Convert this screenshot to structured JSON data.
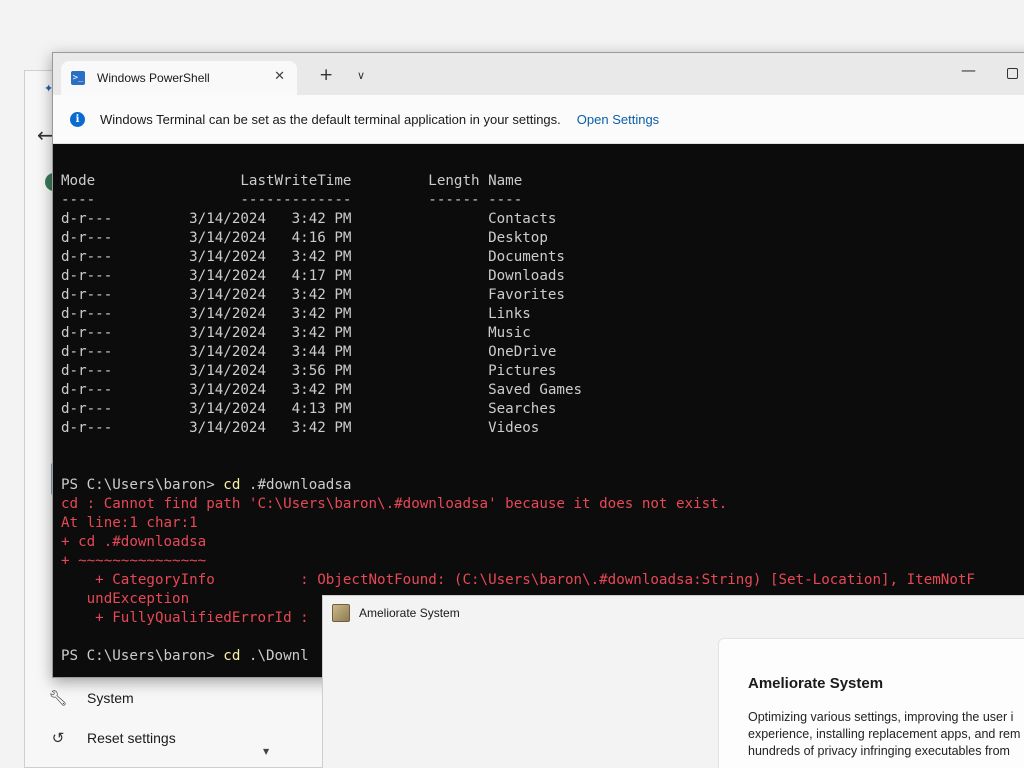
{
  "background_window": {
    "sidebar": [
      {
        "label": "System",
        "icon": "wrench-icon"
      },
      {
        "label": "Reset settings",
        "icon": "history-icon"
      }
    ]
  },
  "terminal": {
    "tab_title": "Windows PowerShell",
    "info_message": "Windows Terminal can be set as the default terminal application in your settings.",
    "info_link": "Open Settings",
    "lines": [
      {
        "text": "Mode                 LastWriteTime         Length Name",
        "style": "normal"
      },
      {
        "text": "----                 -------------         ------ ----",
        "style": "normal"
      },
      {
        "text": "d-r---         3/14/2024   3:42 PM                Contacts",
        "style": "normal"
      },
      {
        "text": "d-r---         3/14/2024   4:16 PM                Desktop",
        "style": "normal"
      },
      {
        "text": "d-r---         3/14/2024   3:42 PM                Documents",
        "style": "normal"
      },
      {
        "text": "d-r---         3/14/2024   4:17 PM                Downloads",
        "style": "normal"
      },
      {
        "text": "d-r---         3/14/2024   3:42 PM                Favorites",
        "style": "normal"
      },
      {
        "text": "d-r---         3/14/2024   3:42 PM                Links",
        "style": "normal"
      },
      {
        "text": "d-r---         3/14/2024   3:42 PM                Music",
        "style": "normal"
      },
      {
        "text": "d-r---         3/14/2024   3:44 PM                OneDrive",
        "style": "normal"
      },
      {
        "text": "d-r---         3/14/2024   3:56 PM                Pictures",
        "style": "normal"
      },
      {
        "text": "d-r---         3/14/2024   3:42 PM                Saved Games",
        "style": "normal"
      },
      {
        "text": "d-r---         3/14/2024   4:13 PM                Searches",
        "style": "normal"
      },
      {
        "text": "d-r---         3/14/2024   3:42 PM                Videos",
        "style": "normal"
      },
      {
        "text": "",
        "style": "normal"
      },
      {
        "text": "",
        "style": "normal"
      },
      {
        "text": "PS C:\\Users\\baron> ",
        "cmd": "cd",
        "rest": " .#downloadsa",
        "style": "prompt"
      },
      {
        "text": "cd : Cannot find path 'C:\\Users\\baron\\.#downloadsa' because it does not exist.",
        "style": "error"
      },
      {
        "text": "At line:1 char:1",
        "style": "error"
      },
      {
        "text": "+ cd .#downloadsa",
        "style": "error"
      },
      {
        "text": "+ ~~~~~~~~~~~~~~~",
        "style": "error"
      },
      {
        "text": "    + CategoryInfo          : ObjectNotFound: (C:\\Users\\baron\\.#downloadsa:String) [Set-Location], ItemNotF",
        "style": "error"
      },
      {
        "text": "   undException",
        "style": "error"
      },
      {
        "text": "    + FullyQualifiedErrorId : ",
        "style": "error"
      },
      {
        "text": "",
        "style": "normal"
      },
      {
        "text": "PS C:\\Users\\baron> ",
        "cmd": "cd",
        "rest": " .\\Downl",
        "style": "prompt"
      }
    ]
  },
  "ameliorate": {
    "window_title": "Ameliorate System",
    "heading": "Ameliorate System",
    "description_lines": [
      "Optimizing various settings, improving the user i",
      "experience, installing replacement apps, and rem",
      "hundreds of privacy infringing executables from"
    ]
  }
}
